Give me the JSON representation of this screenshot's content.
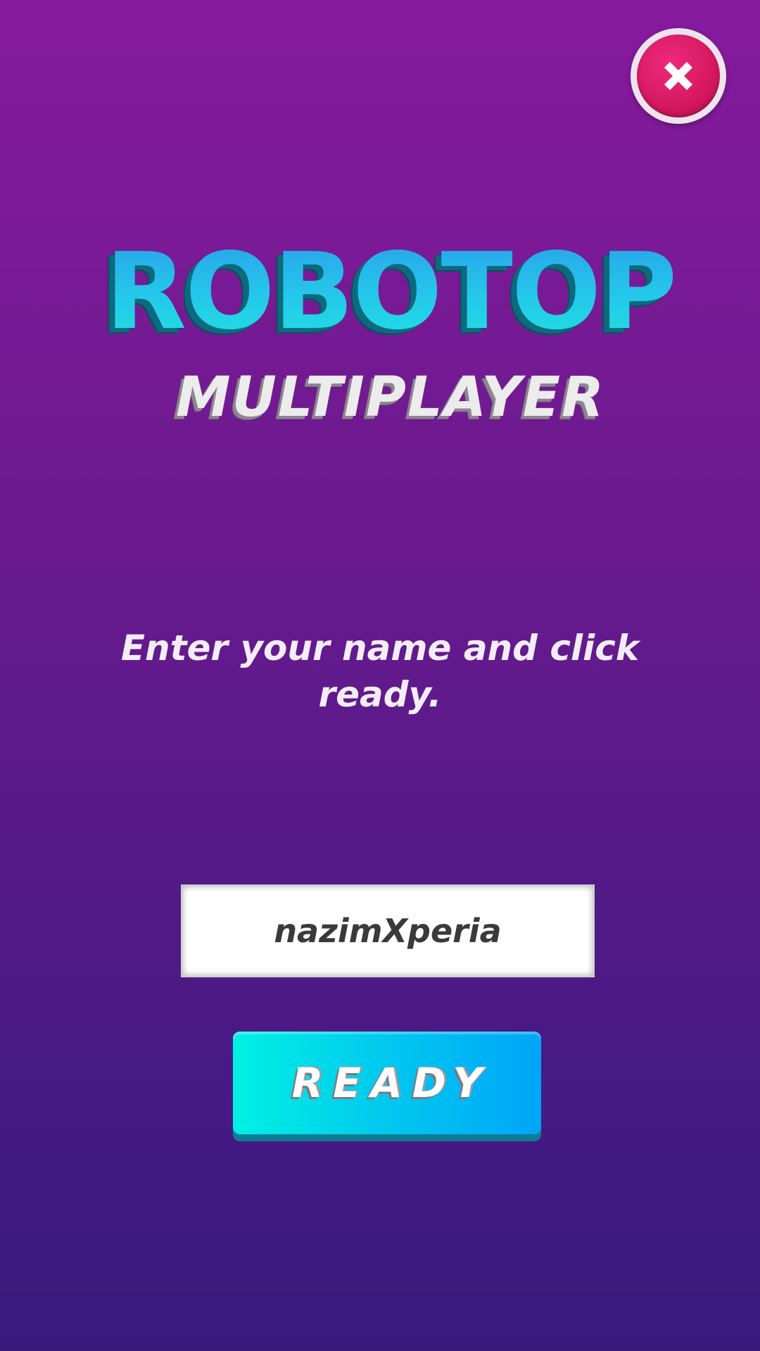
{
  "app": {
    "logo_title": "ROBOTOP",
    "logo_subtitle": "MULTIPLAYER"
  },
  "close_button": {
    "icon": "close-icon"
  },
  "instruction_text": "Enter your name and click ready.",
  "name_field": {
    "value": "nazimXperia"
  },
  "ready_button": {
    "label": "READY"
  },
  "colors": {
    "background_top": "#871a9d",
    "background_bottom": "#381a7d",
    "close_red": "#d5185e",
    "ready_cyan": "#00f1e3",
    "ready_blue": "#00a5f7"
  }
}
